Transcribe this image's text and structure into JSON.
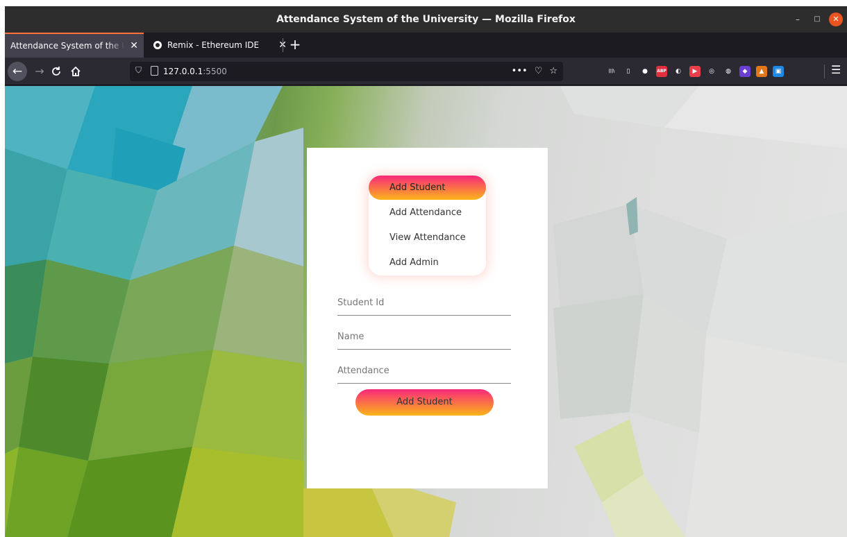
{
  "window": {
    "title": "Attendance System of the University — Mozilla Firefox",
    "minimize_glyph": "–",
    "maximize_glyph": "□",
    "close_glyph": "✕"
  },
  "tabs": [
    {
      "label": "Attendance System of the University",
      "active": true,
      "close_glyph": "✕"
    },
    {
      "label": "Remix - Ethereum IDE",
      "active": false,
      "close_glyph": "✕"
    }
  ],
  "new_tab_glyph": "+",
  "navbar": {
    "url_host": "127.0.0.1",
    "url_port": ":5500",
    "actions": [
      "•••",
      "♡",
      "☆"
    ],
    "menu_glyph": "☰"
  },
  "extensions": [
    {
      "name": "library-icon",
      "label": "|||\\",
      "color": "#2b2a33"
    },
    {
      "name": "sidebar-icon",
      "label": "▯",
      "color": "#2b2a33"
    },
    {
      "name": "account-icon",
      "label": "●",
      "color": "#2b2a33"
    },
    {
      "name": "adblock-icon",
      "label": "ABP",
      "color": "#e0303b"
    },
    {
      "name": "ext-dark-icon",
      "label": "◐",
      "color": "#2b2a33"
    },
    {
      "name": "ext-red-icon",
      "label": "▶",
      "color": "#e8404a"
    },
    {
      "name": "ext-clock-icon",
      "label": "◎",
      "color": "#2b2a33"
    },
    {
      "name": "ext-globe-icon",
      "label": "◍",
      "color": "#2b2a33"
    },
    {
      "name": "ext-purple-icon",
      "label": "◆",
      "color": "#6b3fd4"
    },
    {
      "name": "metamask-icon",
      "label": "▲",
      "color": "#e2761b"
    },
    {
      "name": "ext-blue-icon",
      "label": "▣",
      "color": "#1e88e5"
    }
  ],
  "menu": {
    "items": [
      {
        "label": "Add Student",
        "active": true
      },
      {
        "label": "Add Attendance",
        "active": false
      },
      {
        "label": "View Attendance",
        "active": false
      },
      {
        "label": "Add Admin",
        "active": false
      }
    ]
  },
  "form": {
    "student_id_placeholder": "Student Id",
    "name_placeholder": "Name",
    "attendance_placeholder": "Attendance",
    "submit_label": "Add Student"
  },
  "colors": {
    "gradient_top": "#f9287b",
    "gradient_bottom": "#fbb519",
    "firefox_accent": "#ff7139",
    "ubuntu_close": "#e95420"
  }
}
